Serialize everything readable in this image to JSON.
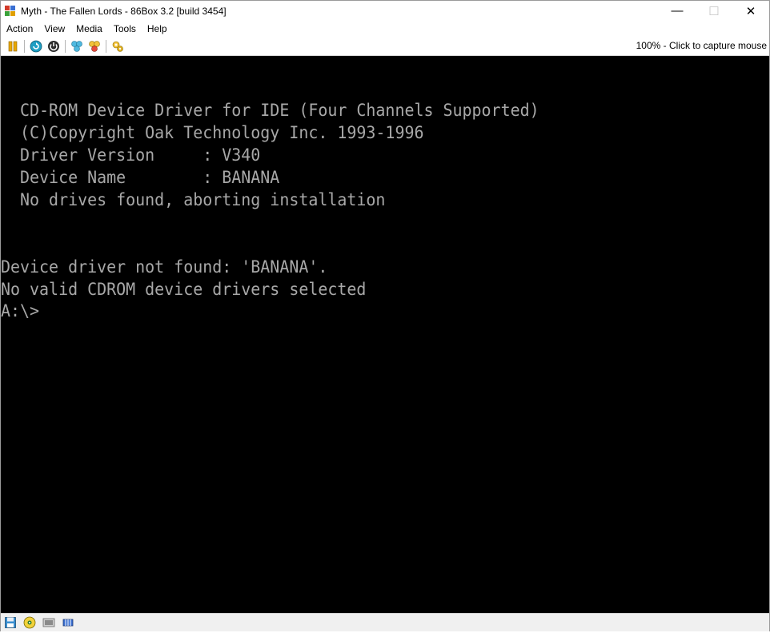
{
  "window": {
    "title": "Myth - The Fallen Lords - 86Box 3.2 [build 3454]",
    "controls": {
      "minimize": "—",
      "maximize": "☐",
      "close": "✕"
    }
  },
  "menu": [
    "Action",
    "View",
    "Media",
    "Tools",
    "Help"
  ],
  "toolbar": {
    "icons": [
      "pause-icon",
      "reset-icon",
      "power-icon",
      "settings-icon",
      "discard-icon",
      "hardware-icon"
    ],
    "capture_status": "100% - Click to capture mouse"
  },
  "screen": {
    "lines": [
      "",
      "",
      "  CD-ROM Device Driver for IDE (Four Channels Supported)",
      "  (C)Copyright Oak Technology Inc. 1993-1996",
      "  Driver Version     : V340",
      "  Device Name        : BANANA",
      "  No drives found, aborting installation",
      "",
      "",
      "Device driver not found: 'BANANA'.",
      "No valid CDROM device drivers selected",
      "A:\\>"
    ]
  },
  "statusbar": {
    "icons": [
      "floppy-icon",
      "cdrom-icon",
      "network-icon",
      "sound-icon"
    ]
  },
  "colors": {
    "screen_bg": "#000000",
    "screen_text": "#a8a8a8",
    "pause_accent": "#e8a800"
  }
}
